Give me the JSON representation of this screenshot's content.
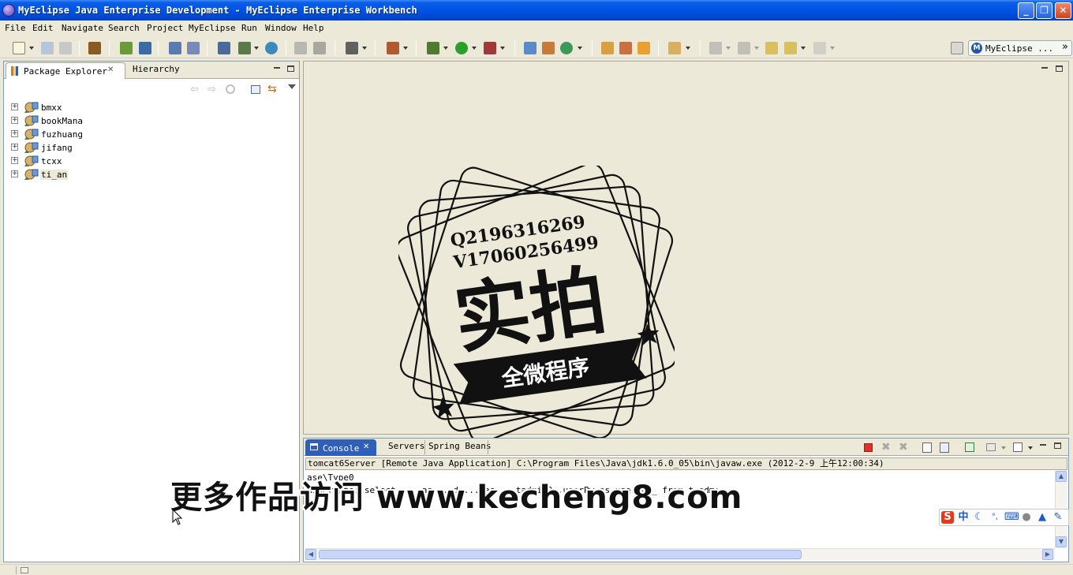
{
  "window": {
    "title": "MyEclipse Java Enterprise Development - MyEclipse Enterprise Workbench",
    "minimize": "_",
    "maximize": "❐",
    "close": "✕"
  },
  "menu": [
    "File",
    "Edit",
    "Navigate",
    "Search",
    "Project",
    "MyEclipse",
    "Run",
    "Window",
    "Help"
  ],
  "perspective": {
    "label": "MyEclipse ...",
    "overflow": "»"
  },
  "left_panel": {
    "tabs": [
      {
        "label": "Package Explorer",
        "active": true,
        "close": "✕"
      },
      {
        "label": "Hierarchy",
        "active": false
      }
    ],
    "projects": [
      "bmxx",
      "bookMana",
      "fuzhuang",
      "jifang",
      "tcxx",
      "ti_an"
    ],
    "selected": "ti_an"
  },
  "console": {
    "tabs": [
      {
        "label": "Console",
        "active": true,
        "close": "✕"
      },
      {
        "label": "Servers",
        "active": false
      },
      {
        "label": "Spring Beans",
        "active": false
      }
    ],
    "description": "tomcat6Server [Remote Java Application] C:\\Program Files\\Java\\jdk1.6.0_05\\bin\\javaw.exe (2012-2-9 上午12:00:34)",
    "lines": [
      "ase\\Type0",
      "Hibernate: select ... as ...d ... as ...tadmin0_.userPw as userPw0_ from t_adm:"
    ]
  },
  "watermark": {
    "line1": "Q2196316269",
    "line2": "V17060256499",
    "big_text": "实拍",
    "ribbon": "全微程序",
    "overlay": "更多作品访问 www.kecheng8.com"
  },
  "ime": {
    "logo": "S",
    "lang": "中",
    "moon": "☾",
    "punct": "°,",
    "keyboard": "⌨",
    "user": "●",
    "shirt": "▲",
    "tool": "✎"
  },
  "colors": {
    "title_bar": "#0054e3",
    "selection": "#ece9d8",
    "stop_red": "#e03030"
  }
}
